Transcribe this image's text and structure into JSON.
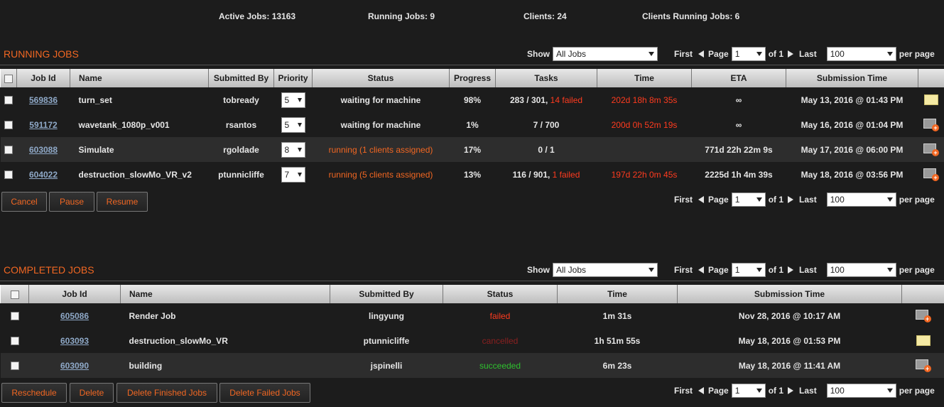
{
  "stats": {
    "active_jobs": "Active Jobs: 13163",
    "running_jobs": "Running Jobs: 9",
    "clients": "Clients: 24",
    "clients_running": "Clients Running Jobs: 6"
  },
  "running": {
    "title": "RUNNING JOBS",
    "show_label": "Show",
    "show_value": "All Jobs",
    "pager": {
      "first": "First",
      "page": "Page",
      "page_value": "1",
      "of": "of 1",
      "last": "Last",
      "per_value": "100",
      "per": "per page"
    },
    "columns": [
      "Job Id",
      "Name",
      "Submitted By",
      "Priority",
      "Status",
      "Progress",
      "Tasks",
      "Time",
      "ETA",
      "Submission Time"
    ],
    "rows": [
      {
        "id": "569836",
        "name": "turn_set",
        "by": "tobready",
        "priority": "5",
        "status": "waiting for machine",
        "progress": "98%",
        "tasks": "283 / 301,",
        "failed": "14 failed",
        "time": "202d 18h 8m 35s",
        "eta": "∞",
        "submitted": "May 13, 2016 @ 01:43 PM"
      },
      {
        "id": "591172",
        "name": "wavetank_1080p_v001",
        "by": "rsantos",
        "priority": "5",
        "status": "waiting for machine",
        "progress": "1%",
        "tasks": "7 / 700",
        "failed": "",
        "time": "200d 0h 52m 19s",
        "eta": "∞",
        "submitted": "May 16, 2016 @ 01:04 PM"
      },
      {
        "id": "603088",
        "name": "Simulate",
        "by": "rgoldade",
        "priority": "8",
        "status": "running (1 clients assigned)",
        "progress": "17%",
        "tasks": "0 / 1",
        "failed": "",
        "time": "",
        "eta": "771d 22h 22m 9s",
        "submitted": "May 17, 2016 @ 06:00 PM"
      },
      {
        "id": "604022",
        "name": "destruction_slowMo_VR_v2",
        "by": "ptunnicliffe",
        "priority": "7",
        "status": "running (5 clients assigned)",
        "progress": "13%",
        "tasks": "116 / 901,",
        "failed": "1 failed",
        "time": "197d 22h 0m 45s",
        "eta": "2225d 1h 4m 39s",
        "submitted": "May 18, 2016 @ 03:56 PM"
      }
    ],
    "buttons": {
      "cancel": "Cancel",
      "pause": "Pause",
      "resume": "Resume"
    }
  },
  "completed": {
    "title": "COMPLETED JOBS",
    "show_label": "Show",
    "show_value": "All Jobs",
    "pager": {
      "first": "First",
      "page": "Page",
      "page_value": "1",
      "of": "of 1",
      "last": "Last",
      "per_value": "100",
      "per": "per page"
    },
    "columns": [
      "Job Id",
      "Name",
      "Submitted By",
      "Status",
      "Time",
      "Submission Time"
    ],
    "rows": [
      {
        "id": "605086",
        "name": "Render Job",
        "by": "lingyung",
        "status": "failed",
        "time": "1m 31s",
        "submitted": "Nov 28, 2016 @ 10:17 AM"
      },
      {
        "id": "603093",
        "name": "destruction_slowMo_VR",
        "by": "ptunnicliffe",
        "status": "cancelled",
        "time": "1h 51m 55s",
        "submitted": "May 18, 2016 @ 01:53 PM"
      },
      {
        "id": "603090",
        "name": "building",
        "by": "jspinelli",
        "status": "succeeded",
        "time": "6m 23s",
        "submitted": "May 18, 2016 @ 11:41 AM"
      }
    ],
    "buttons": {
      "reschedule": "Reschedule",
      "delete": "Delete",
      "delete_finished": "Delete Finished Jobs",
      "delete_failed": "Delete Failed Jobs"
    }
  },
  "icons": {
    "note": "note-icon",
    "add_note": "add-note-icon"
  },
  "colors": {
    "accent": "#f26722",
    "failed": "#ff3b1f",
    "cancelled": "#8a2020",
    "succeeded": "#2ec12e",
    "link": "#8fa9c8"
  }
}
